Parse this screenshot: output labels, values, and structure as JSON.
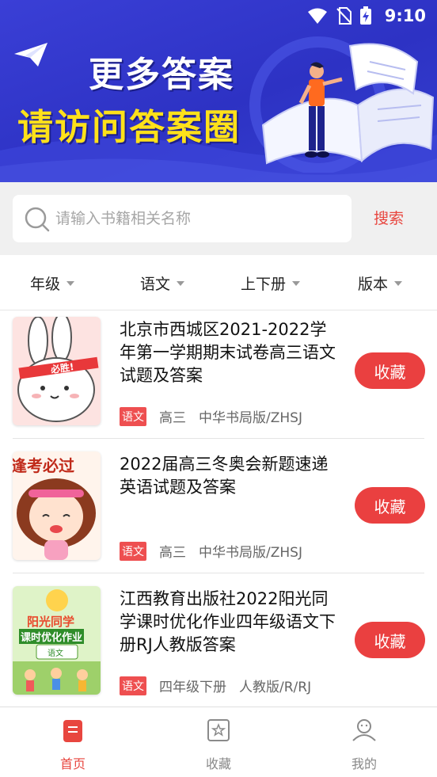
{
  "status_bar": {
    "time": "9:10"
  },
  "banner": {
    "line1": "更多答案",
    "line2": "请访问答案圈"
  },
  "search": {
    "placeholder": "请输入书籍相关名称",
    "button_label": "搜索"
  },
  "filters": [
    {
      "label": "年级"
    },
    {
      "label": "语文"
    },
    {
      "label": "上下册"
    },
    {
      "label": "版本"
    }
  ],
  "items": [
    {
      "title": "北京市西城区2021-2022学年第一学期期末试卷高三语文试题及答案",
      "subject": "语文",
      "grade": "高三",
      "publisher": "中华书局版/ZHSJ",
      "button_label": "收藏"
    },
    {
      "title": "2022届高三冬奥会新题速递英语试题及答案",
      "subject": "语文",
      "grade": "高三",
      "publisher": "中华书局版/ZHSJ",
      "button_label": "收藏"
    },
    {
      "title": "江西教育出版社2022阳光同学课时优化作业四年级语文下册RJ人教版答案",
      "subject": "语文",
      "grade": "四年级下册",
      "publisher": "人教版/R/RJ",
      "button_label": "收藏"
    }
  ],
  "thumbs": {
    "t1_text": "必胜!",
    "t2_text": "逢考必过",
    "t3_line1": "阳光同学",
    "t3_line2": "课时优化作业",
    "t3_tag": "语文"
  },
  "nav": [
    {
      "label": "首页",
      "active": true
    },
    {
      "label": "收藏",
      "active": false
    },
    {
      "label": "我的",
      "active": false
    }
  ],
  "colors": {
    "accent": "#e8463f",
    "banner": "#3a3fd6",
    "slogan_yellow": "#ffe11a"
  }
}
